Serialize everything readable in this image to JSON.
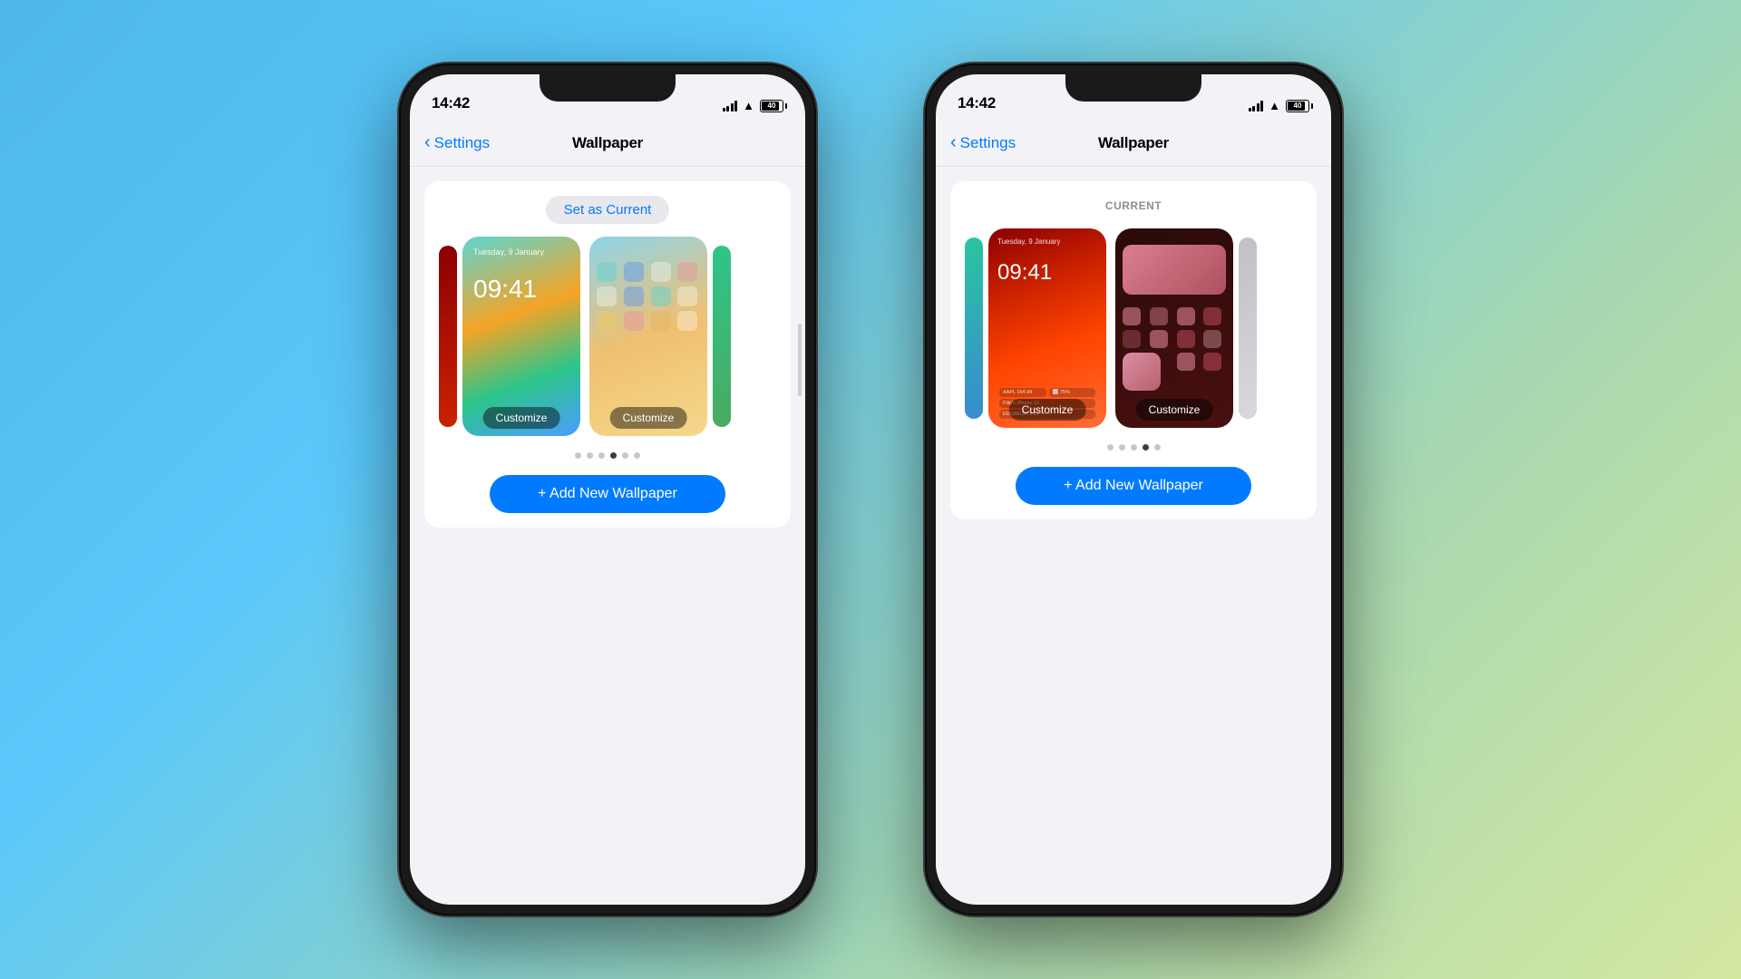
{
  "background": {
    "gradient": "linear-gradient(135deg, #4db8e8 0%, #5ac8fa 30%, #a8d8b0 70%, #d4e8a0 100%)"
  },
  "phone_left": {
    "status": {
      "time": "14:42",
      "battery": "40"
    },
    "nav": {
      "back_label": "Settings",
      "title": "Wallpaper"
    },
    "card": {
      "set_as_current": "Set as Current",
      "customize_lock": "Customize",
      "customize_home": "Customize",
      "add_wallpaper": "+ Add New Wallpaper"
    },
    "dots": [
      false,
      false,
      false,
      true,
      false,
      false
    ]
  },
  "phone_right": {
    "status": {
      "time": "14:42",
      "battery": "40"
    },
    "nav": {
      "back_label": "Settings",
      "title": "Wallpaper"
    },
    "card": {
      "current_label": "CURRENT",
      "customize_lock": "Customize",
      "customize_home": "Customize",
      "add_wallpaper": "+ Add New Wallpaper"
    },
    "dots": [
      false,
      false,
      false,
      true,
      false
    ]
  }
}
